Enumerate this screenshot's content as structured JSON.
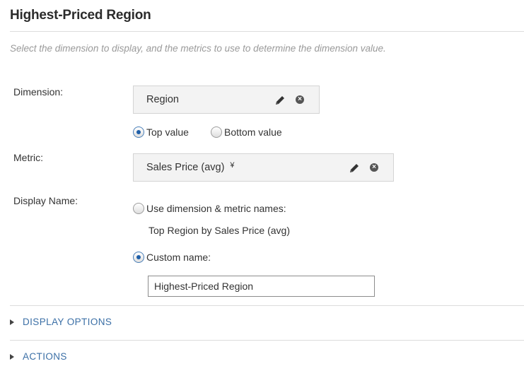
{
  "panel": {
    "title": "Highest-Priced Region",
    "description": "Select the dimension to display, and the metrics to use to determine the dimension value."
  },
  "dimension": {
    "label": "Dimension:",
    "value": "Region",
    "edit_icon": "pencil-icon",
    "remove_icon": "close-circle-icon",
    "options": [
      {
        "label": "Top value",
        "selected": true
      },
      {
        "label": "Bottom value",
        "selected": false
      }
    ]
  },
  "metric": {
    "label": "Metric:",
    "value": "Sales Price (avg)",
    "expand_icon": "double-chevron-down-icon",
    "expand_glyph": "¥",
    "edit_icon": "pencil-icon",
    "remove_icon": "close-circle-icon"
  },
  "display_name": {
    "label": "Display Name:",
    "use_names_label": "Use dimension & metric names:",
    "use_names_selected": false,
    "generated_name": "Top Region by Sales Price (avg)",
    "custom_label": "Custom name:",
    "custom_selected": true,
    "custom_value": "Highest-Priced Region"
  },
  "sections": [
    {
      "label": "DISPLAY OPTIONS",
      "icon": "triangle-right-icon"
    },
    {
      "label": "ACTIONS",
      "icon": "triangle-right-icon"
    }
  ],
  "colors": {
    "link": "#3b6fa6",
    "radio_selected": "#1f5fa8"
  }
}
